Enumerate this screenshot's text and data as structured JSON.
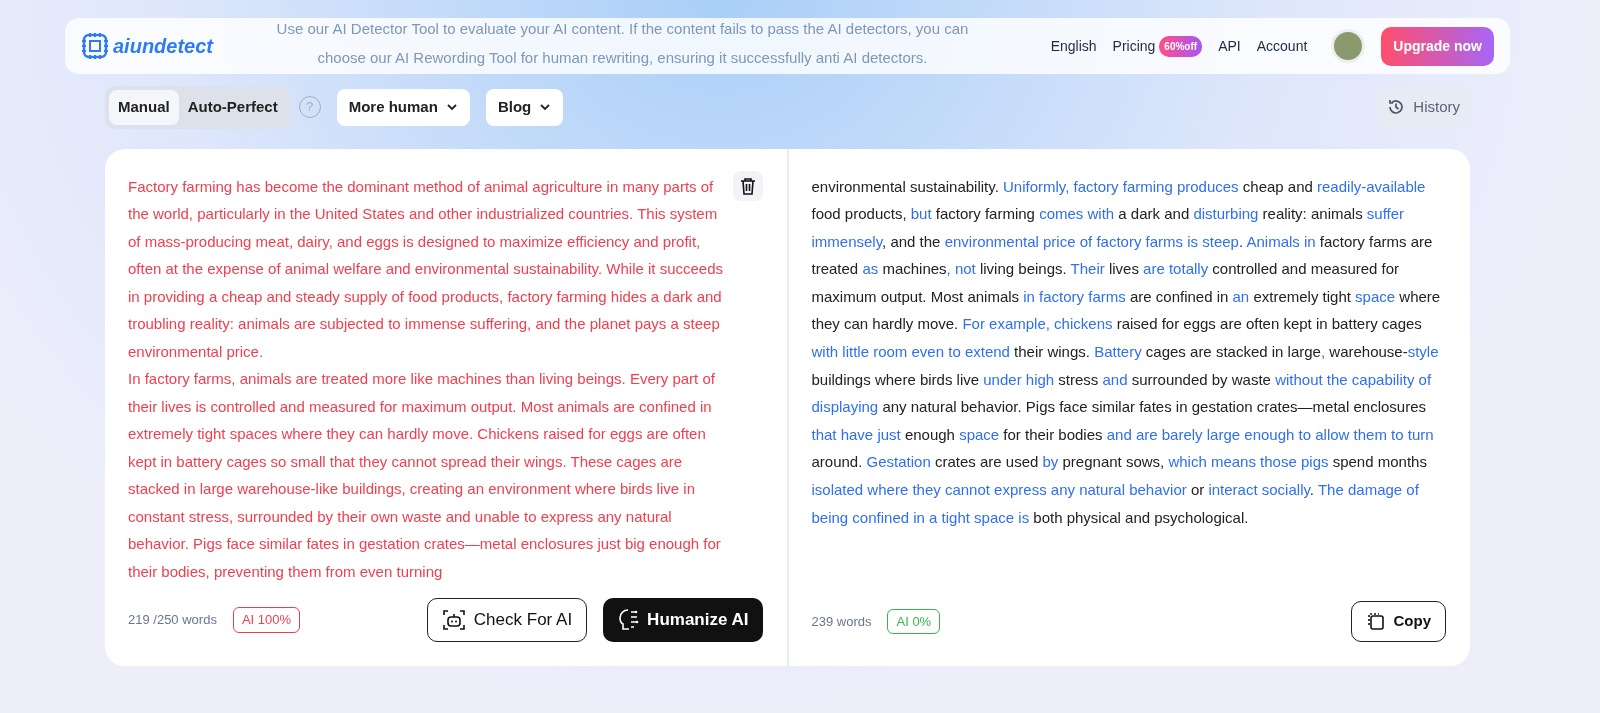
{
  "header": {
    "logo_text": "aiundetect",
    "tagline": "Use our AI Detector Tool to evaluate your AI content. If the content fails to pass the AI detectors, you can choose our AI Rewording Tool for human rewriting, ensuring it successfully anti AI detectors.",
    "nav": [
      {
        "label": "English"
      },
      {
        "label": "Pricing",
        "badge": "60%off"
      },
      {
        "label": "API"
      },
      {
        "label": "Account"
      }
    ],
    "upgrade_button": "Upgrade now"
  },
  "toolbar": {
    "help_icon": "?",
    "modes": [
      {
        "label": "Manual",
        "selected": true
      },
      {
        "label": "Auto-Perfect",
        "selected": false
      }
    ],
    "dropdowns": [
      {
        "label": "More human"
      },
      {
        "label": "Blog"
      }
    ],
    "history_button": "History"
  },
  "input_panel": {
    "paragraphs": [
      "Factory farming has become the dominant method of animal agriculture in many parts of the world, particularly in the United States and other industrialized countries. This system of mass-producing meat, dairy, and eggs is designed to maximize efficiency and profit, often at the expense of animal welfare and environmental sustainability. While it succeeds in providing a cheap and steady supply of food products, factory farming hides a dark and troubling reality: animals are subjected to immense suffering, and the planet pays a steep environmental price.",
      "In factory farms, animals are treated more like machines than living beings. Every part of their lives is controlled and measured for maximum output. Most animals are confined in extremely tight spaces where they can hardly move. Chickens raised for eggs are often kept in battery cages so small that they cannot spread their wings. These cages are stacked in large warehouse-like buildings, creating an environment where birds live in constant stress, surrounded by their own waste and unable to express any natural behavior. Pigs face similar fates in gestation crates—metal enclosures just big enough for their bodies, preventing them from even turning"
    ],
    "word_count": "219 /250 words",
    "ai_score": {
      "text": "AI 100%",
      "color": "#ef4050"
    },
    "check_button": "Check For AI",
    "humanize_button": "Humanize AI"
  },
  "output_panel": {
    "segments": [
      {
        "text": "environmental sustainability. ",
        "changed": false
      },
      {
        "text": "Uniformly, factory farming produces",
        "changed": true
      },
      {
        "text": " cheap and ",
        "changed": false
      },
      {
        "text": "readily-available",
        "changed": true
      },
      {
        "text": " food products, ",
        "changed": false
      },
      {
        "text": "but",
        "changed": true
      },
      {
        "text": " factory farming ",
        "changed": false
      },
      {
        "text": "comes with",
        "changed": true
      },
      {
        "text": " a dark and ",
        "changed": false
      },
      {
        "text": "disturbing",
        "changed": true
      },
      {
        "text": " reality: animals ",
        "changed": false
      },
      {
        "text": "suffer immensely",
        "changed": true
      },
      {
        "text": ", and the ",
        "changed": false
      },
      {
        "text": "environmental price of factory farms is steep",
        "changed": true
      },
      {
        "text": ". ",
        "changed": false
      },
      {
        "text": "Animals in",
        "changed": true
      },
      {
        "text": " factory farms are treated ",
        "changed": false
      },
      {
        "text": "as",
        "changed": true
      },
      {
        "text": " machines",
        "changed": false
      },
      {
        "text": ", not",
        "changed": true
      },
      {
        "text": " living beings. ",
        "changed": false
      },
      {
        "text": "Their",
        "changed": true
      },
      {
        "text": " lives ",
        "changed": false
      },
      {
        "text": "are totally",
        "changed": true
      },
      {
        "text": " controlled and measured for maximum output. Most animals ",
        "changed": false
      },
      {
        "text": "in factory farms",
        "changed": true
      },
      {
        "text": " are confined in ",
        "changed": false
      },
      {
        "text": "an",
        "changed": true
      },
      {
        "text": " extremely tight ",
        "changed": false
      },
      {
        "text": "space",
        "changed": true
      },
      {
        "text": " where they can hardly move. ",
        "changed": false
      },
      {
        "text": "For example, chickens",
        "changed": true
      },
      {
        "text": " raised for eggs are often kept in battery cages ",
        "changed": false
      },
      {
        "text": "with little room even to extend",
        "changed": true
      },
      {
        "text": " their wings. ",
        "changed": false
      },
      {
        "text": "Battery",
        "changed": true
      },
      {
        "text": " cages are stacked in large",
        "changed": false
      },
      {
        "text": ",",
        "changed": true
      },
      {
        "text": " warehouse-",
        "changed": false
      },
      {
        "text": "style",
        "changed": true
      },
      {
        "text": " buildings where birds live ",
        "changed": false
      },
      {
        "text": "under high",
        "changed": true
      },
      {
        "text": " stress ",
        "changed": false
      },
      {
        "text": "and",
        "changed": true
      },
      {
        "text": " surrounded by waste ",
        "changed": false
      },
      {
        "text": "without the capability of displaying",
        "changed": true
      },
      {
        "text": " any natural behavior. Pigs face similar fates in gestation crates—metal enclosures ",
        "changed": false
      },
      {
        "text": "that have just",
        "changed": true
      },
      {
        "text": " enough ",
        "changed": false
      },
      {
        "text": "space",
        "changed": true
      },
      {
        "text": " for their bodies ",
        "changed": false
      },
      {
        "text": "and are barely large enough to allow them to turn",
        "changed": true
      },
      {
        "text": " around. ",
        "changed": false
      },
      {
        "text": "Gestation",
        "changed": true
      },
      {
        "text": " crates are used ",
        "changed": false
      },
      {
        "text": "by",
        "changed": true
      },
      {
        "text": " pregnant sows, ",
        "changed": false
      },
      {
        "text": "which means those pigs",
        "changed": true
      },
      {
        "text": " spend months ",
        "changed": false
      },
      {
        "text": "isolated where they cannot express any natural behavior",
        "changed": true
      },
      {
        "text": " or ",
        "changed": false
      },
      {
        "text": "interact socially",
        "changed": true
      },
      {
        "text": ". ",
        "changed": false
      },
      {
        "text": "The damage of being confined in a tight space is",
        "changed": true
      },
      {
        "text": " both physical and psychological.",
        "changed": false
      }
    ],
    "word_count": "239 words",
    "ai_score": {
      "text": "AI 0%",
      "color": "#3cb44b"
    },
    "copy_button": "Copy"
  }
}
